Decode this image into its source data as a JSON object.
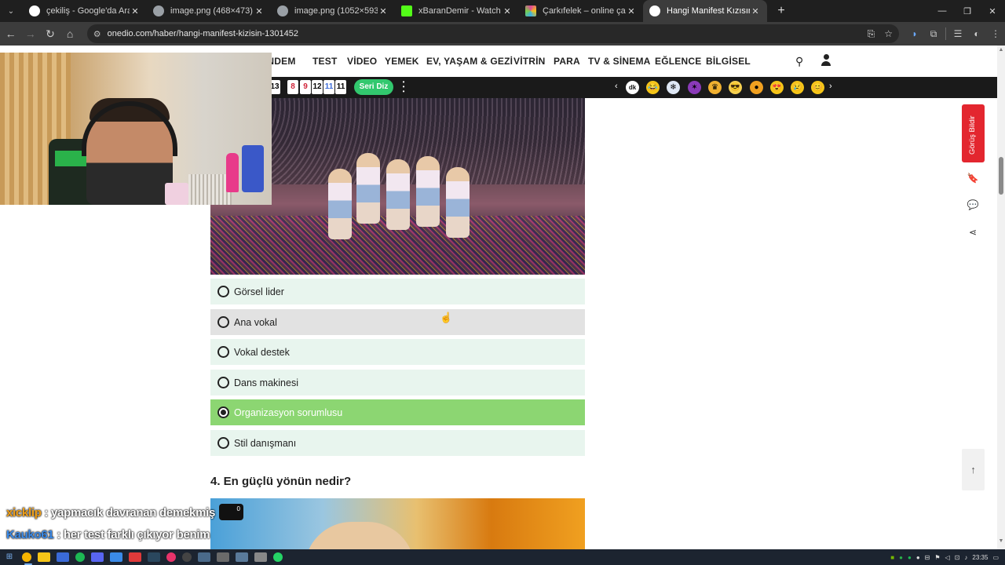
{
  "browser": {
    "tabs": [
      {
        "title": "çekiliş - Google'da Ara",
        "favicon_color": "#ffffff",
        "active": false
      },
      {
        "title": "image.png (468×473)",
        "favicon_color": "#9aa0a6",
        "active": false
      },
      {
        "title": "image.png (1052×593)",
        "favicon_color": "#9aa0a6",
        "active": false
      },
      {
        "title": "xBaranDemir - Watch clips on K",
        "favicon_color": "#53fc18",
        "active": false
      },
      {
        "title": "Çarkıfelek – online çark çevirme",
        "favicon_color": "#e0449a",
        "active": false
      },
      {
        "title": "Hangi Manifest Kızısın? - Onedi",
        "favicon_color": "#ffffff",
        "active": true
      }
    ],
    "url": "onedio.com/haber/hangi-manifest-kizisin-1301452"
  },
  "site_nav": {
    "items": [
      "GÜNDEM",
      "TEST",
      "VİDEO",
      "YEMEK",
      "EV, YAŞAM & GEZİ",
      "VİTRİN",
      "PARA",
      "TV & SİNEMA",
      "EĞLENCE",
      "BİLGİSEL"
    ]
  },
  "ticker": {
    "numbers": [
      "13",
      "8",
      "9",
      "12",
      "11",
      "11"
    ],
    "number_colors": [
      "#222222",
      "#d0243a",
      "#d0243a",
      "#222222",
      "#3a6ad8",
      "#222222"
    ],
    "series_button": "Seri Diz"
  },
  "question": {
    "options": [
      {
        "label": "Görsel lider",
        "state": "normal"
      },
      {
        "label": "Ana vokal",
        "state": "hover"
      },
      {
        "label": "Vokal destek",
        "state": "normal"
      },
      {
        "label": "Dans makinesi",
        "state": "normal"
      },
      {
        "label": "Organizasyon sorumlusu",
        "state": "selected"
      },
      {
        "label": "Stil danışmanı",
        "state": "normal"
      }
    ]
  },
  "next_question": {
    "title": "4. En güçlü yönün nedir?"
  },
  "sidebar": {
    "feedback_label": "Görüş Bildir"
  },
  "chat": {
    "messages": [
      {
        "user": "xicklip",
        "user_color": "#f0a018",
        "text": ": yapmacık davranan demekmiş"
      },
      {
        "user": "Kauko61",
        "user_color": "#3a8ae8",
        "text": ": her test farklı çıkıyor benim"
      }
    ],
    "badge": "0"
  },
  "taskbar": {
    "time": "23:35"
  }
}
